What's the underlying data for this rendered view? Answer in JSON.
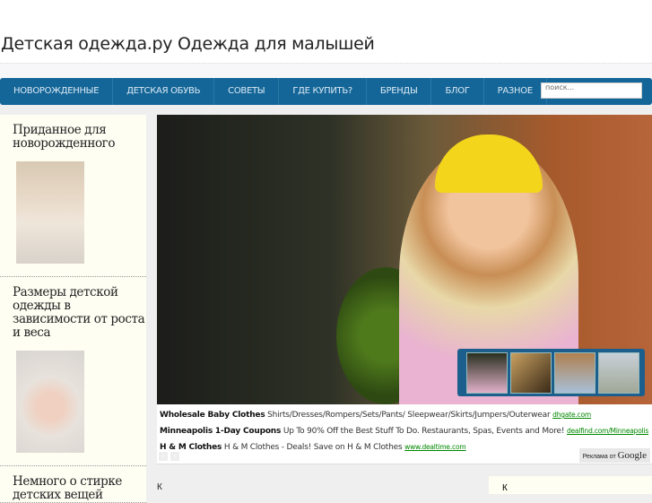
{
  "site": {
    "title": "Детская одежда.ру Одежда для малышей"
  },
  "nav": {
    "items": [
      "НОВОРОЖДЕННЫЕ",
      "ДЕТСКАЯ ОБУВЬ",
      "СОВЕТЫ",
      "ГДЕ КУПИТЬ?",
      "БРЕНДЫ",
      "БЛОГ",
      "РАЗНОЕ"
    ],
    "search_placeholder": "поиск..."
  },
  "sidebar": {
    "items": [
      {
        "title": "Приданное для новорожденного"
      },
      {
        "title": "Размеры детской одежды в зависимости от роста и веса"
      },
      {
        "title": "Немного о стирке детских вещей"
      }
    ]
  },
  "ads": [
    {
      "title": "Wholesale Baby Clothes",
      "text": "Shirts/Dresses/Rompers/Sets/Pants/ Sleepwear/Skirts/Jumpers/Outerwear",
      "url": "dhgate.com"
    },
    {
      "title": "Minneapolis 1-Day Coupons",
      "text": "Up To 90% Off the Best Stuff To Do. Restaurants, Spas, Events and More!",
      "url": "dealfind.com/Minneapolis"
    },
    {
      "title": "H & M Clothes",
      "text": "H & M Clothes - Deals! Save on H & M Clothes",
      "url": "www.dealtime.com"
    }
  ],
  "ad_badge": {
    "prefix": "Реклама от",
    "brand": "Google"
  },
  "bottom": {
    "left": "К",
    "right": "К"
  }
}
